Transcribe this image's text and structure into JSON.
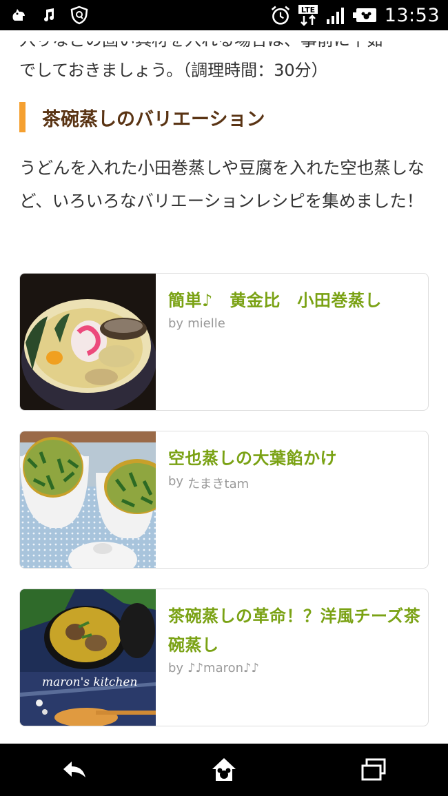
{
  "status_bar": {
    "time": "13:53",
    "network": "LTE"
  },
  "intro": {
    "lines": [
      "入りなどの固い具材を入れる場合は、事前に下茹",
      "でしておきましょう。（調理時間：30分）"
    ]
  },
  "section": {
    "title": "茶碗蒸しのバリエーション",
    "accent_color": "#f5a030"
  },
  "description": "うどんを入れた小田巻蒸しや豆腐を入れた空也蒸しなど、いろいろなバリエーションレシピを集めました！",
  "recipes": [
    {
      "title": "簡単♪　黄金比　小田巻蒸し",
      "by_prefix": "by",
      "author": "mielle",
      "image": "odamaki-mushi-photo"
    },
    {
      "title": "空也蒸しの大葉餡かけ",
      "by_prefix": "by",
      "author": "たまきtam",
      "image": "kuuya-mushi-photo"
    },
    {
      "title": "茶碗蒸しの革命！？洋風チーズ茶碗蒸し",
      "by_prefix": "by",
      "author": "♪♪maron♪♪",
      "image": "cheese-chawanmushi-photo",
      "watermark": "maron's kitchen"
    }
  ],
  "nav": {
    "back_icon": "back-arrow-icon",
    "home_icon": "home-icon",
    "recents_icon": "recents-icon"
  },
  "colors": {
    "title_green": "#7aa214",
    "section_brown": "#5a3414"
  }
}
